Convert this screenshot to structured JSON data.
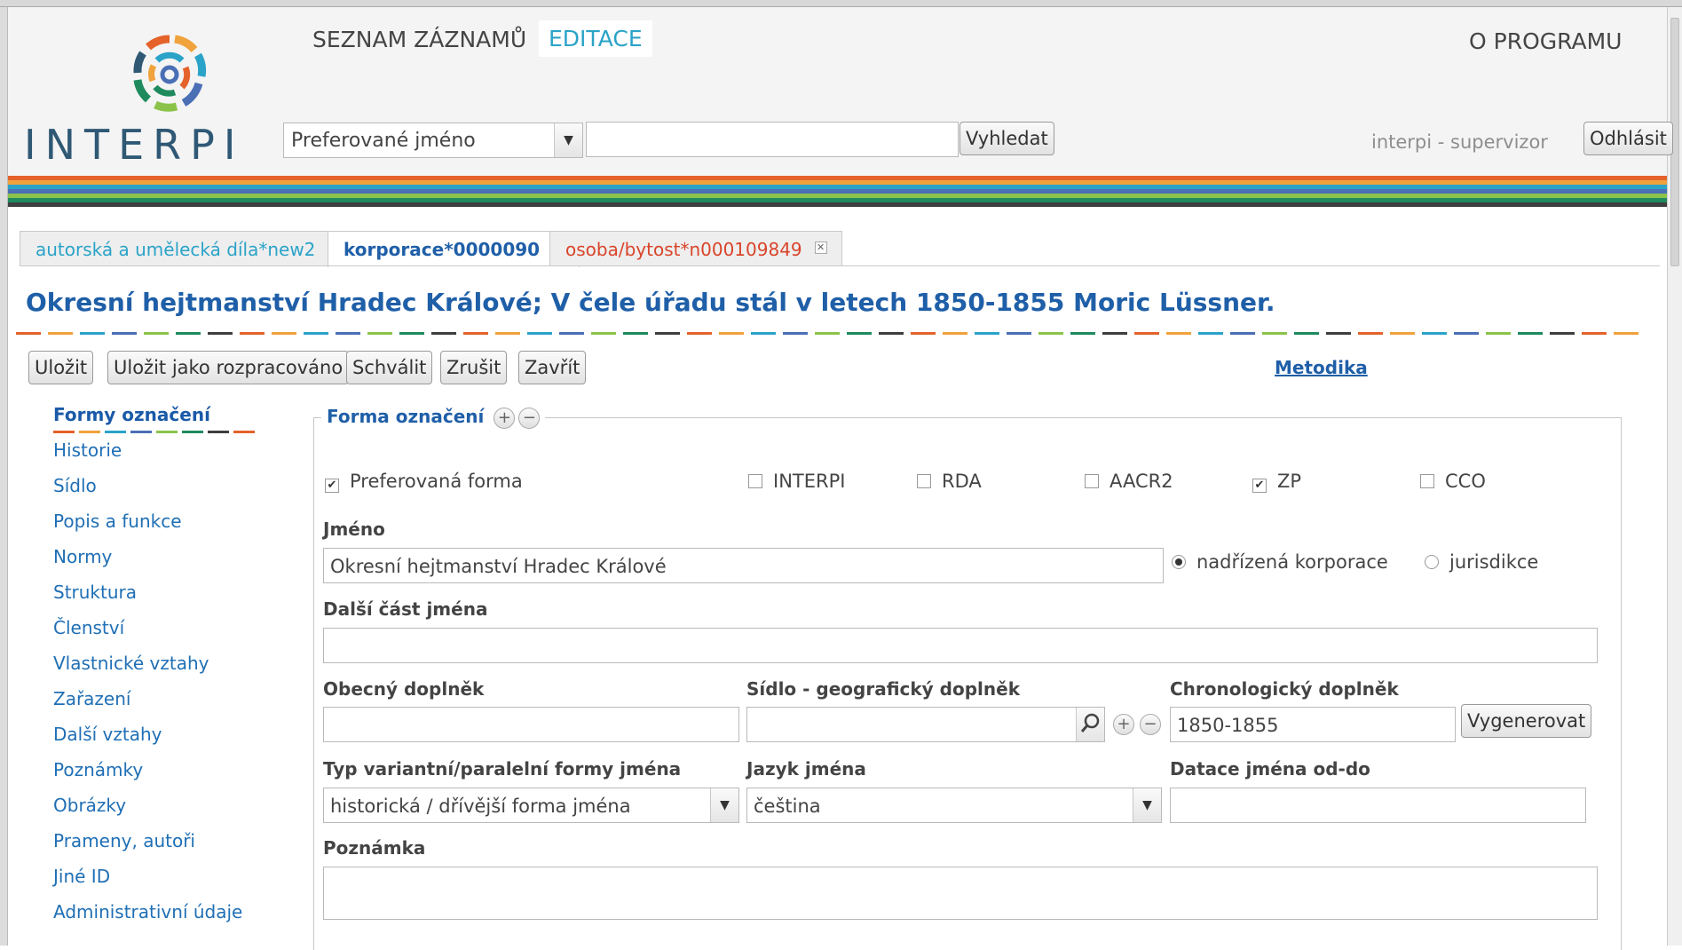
{
  "app": {
    "logo_text": "INTERPI",
    "nav": {
      "records_label": "SEZNAM ZÁZNAMŮ",
      "edit_label": "EDITACE",
      "about_label": "O PROGRAMU"
    },
    "search": {
      "field_select": "Preferované jméno",
      "query": "",
      "search_button": "Vyhledat"
    },
    "user": "interpi - supervizor",
    "logout_button": "Odhlásit",
    "stripe_colors": [
      "#e5622b",
      "#f0a23c",
      "#2aa3c8",
      "#4a6fb5",
      "#8bc34a",
      "#1e8a5e",
      "#3e3e3e"
    ]
  },
  "tabs": [
    {
      "label": "autorská a umělecká díla*new2",
      "color": "#2aa3c8",
      "active": false
    },
    {
      "label": "korporace*0000090",
      "color": "#1f5fa8",
      "active": true
    },
    {
      "label": "osoba/bytost*n000109849",
      "color": "#d9452a",
      "active": false
    }
  ],
  "record": {
    "title": "Okresní hejtmanství Hradec Králové; V čele úřadu stál v letech 1850-1855 Moric Lüssner."
  },
  "toolbar": {
    "save": "Uložit",
    "save_draft": "Uložit jako rozpracováno",
    "approve": "Schválit",
    "cancel": "Zrušit",
    "close": "Zavřít",
    "methodology": "Metodika"
  },
  "sidebar": {
    "items": [
      "Formy označení",
      "Historie",
      "Sídlo",
      "Popis a funkce",
      "Normy",
      "Struktura",
      "Členství",
      "Vlastnické vztahy",
      "Zařazení",
      "Další vztahy",
      "Poznámky",
      "Obrázky",
      "Prameny, autoři",
      "Jiné ID",
      "Administrativní údaje"
    ]
  },
  "form": {
    "legend": "Forma označení",
    "checkboxes": {
      "preferred": {
        "label": "Preferovaná forma",
        "checked": true
      },
      "interpi": {
        "label": "INTERPI",
        "checked": false
      },
      "rda": {
        "label": "RDA",
        "checked": false
      },
      "aacr2": {
        "label": "AACR2",
        "checked": false
      },
      "zp": {
        "label": "ZP",
        "checked": true
      },
      "cco": {
        "label": "CCO",
        "checked": false
      }
    },
    "name_label": "Jméno",
    "name_value": "Okresní hejtmanství Hradec Králové",
    "radio_parent": "nadřízená korporace",
    "radio_jurisdiction": "jurisdikce",
    "next_part_label": "Další část jména",
    "next_part_value": "",
    "general_label": "Obecný doplněk",
    "general_value": "",
    "seat_label": "Sídlo - geografický doplněk",
    "seat_value": "",
    "chrono_label": "Chronologický doplněk",
    "chrono_value": "1850-1855",
    "generate_button": "Vygenerovat",
    "variant_type_label": "Typ variantní/paralelní formy jména",
    "variant_type_value": "historická / dřívější forma jména",
    "language_label": "Jazyk jména",
    "language_value": "čeština",
    "dating_label": "Datace jména od-do",
    "dating_value": "",
    "note_label": "Poznámka",
    "note_value": ""
  }
}
